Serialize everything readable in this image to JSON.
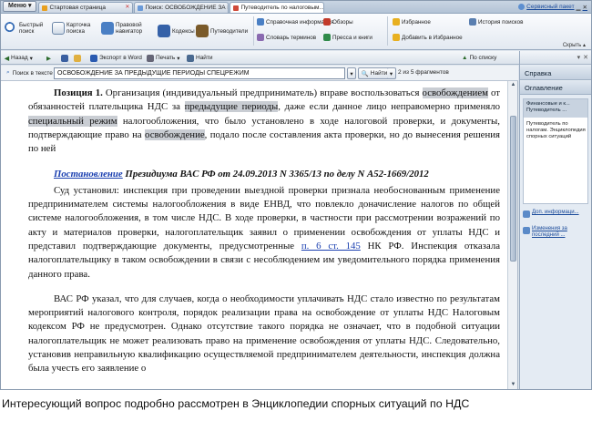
{
  "tabbar": {
    "menu_label": "Меню",
    "tabs": [
      {
        "label": "Стартовая страница",
        "active": false
      },
      {
        "label": "Поиск: ОСВОБОЖДЕНИЕ ЗА ПРЕД...",
        "active": false
      },
      {
        "label": "Путеводитель по налоговым...",
        "active": true
      }
    ],
    "service_label": "Сервисный пакет"
  },
  "ribbon": {
    "quick_search": "Быстрый поиск",
    "card_search": "Карточка поиска",
    "legal_navigator": "Правовой навигатор",
    "codes": "Кодексы",
    "guides": "Путеводители",
    "reference": "Справочная информация",
    "dictionary": "Словарь терминов",
    "reviews": "Обзоры",
    "press": "Пресса и книги",
    "favorites": "Избранное",
    "add_favorites": "Добавить в Избранное",
    "history": "История поисков",
    "collapse": "Скрыть"
  },
  "navbar": {
    "back": "Назад",
    "export_word": "Экспорт в Word",
    "print": "Печать",
    "find": "Найти",
    "by_list": "По списку"
  },
  "findbar": {
    "label": "Поиск в тексте",
    "query": "ОСВОБОЖДЕНИЕ ЗА ПРЕДЫДУЩИЕ ПЕРИОДЫ СПЕЦРЕЖИМ",
    "find_button": "Найти",
    "count": "2 из 5 фрагментов"
  },
  "document": {
    "p1_label": "Позиция 1.",
    "p1_a": " Организация (индивидуальный предприниматель) вправе воспользоваться ",
    "p1_h1": "освобождением",
    "p1_b": " от обязанностей плательщика НДС за ",
    "p1_h2": "предыдущие периоды",
    "p1_c": ", даже если данное лицо неправомерно применяло ",
    "p1_h3": "специальный режим",
    "p1_d": " налогообложения, что было установлено в ходе налоговой проверки, и документы, подтверждающие право на ",
    "p1_h4": "освобождение",
    "p1_e": ", подало после составления акта проверки, но до вынесения решения по ней",
    "ruling_link": "Постановление",
    "ruling_rest": " Президиума ВАС РФ от 24.09.2013 N 3365/13 по делу N А52-1669/2012",
    "p2_a": "Суд установил: инспекция при проведении выездной проверки признала необоснованным применение предпринимателем системы налогообложения в виде ЕНВД, что повлекло доначисление налогов по общей системе налогообложения, в том числе НДС. В ходе проверки, в частности при рассмотрении возражений по акту и материалов проверки, налогоплательщик заявил о применении освобождения от уплаты НДС и представил подтверждающие документы, предусмотренные ",
    "p2_link": "п. 6 ст. 145",
    "p2_b": " НК РФ. Инспекция отказала налогоплательщику в таком освобождении в связи с несоблюдением им уведомительного порядка применения данного права.",
    "p3": "ВАС РФ указал, что для случаев, когда о необходимости уплачивать НДС стало известно по результатам мероприятий налогового контроля, порядок реализации права на освобождение от уплаты НДС Налоговым кодексом РФ не предусмотрен. Однако отсутствие такого порядка не означает, что в подобной ситуации налогоплательщик не может реализовать право на применение освобождения от уплаты НДС. Следовательно, установив неправильную квалификацию осуществляемой предпринимателем деятельности, инспекция должна была учесть его заявление о"
  },
  "panel": {
    "tab_reference": "Справка",
    "tab_contents": "Оглавление",
    "selected_item": "Финансовые и к... Путеводитель ...",
    "box_text": "Путеводитель по налогам. Энциклопедия спорных ситуаций",
    "link1": "Доп. информаци...",
    "link2": "Изменения за последний ..."
  },
  "caption": "Интересующий вопрос подробно рассмотрен в Энциклопедии спорных ситуаций по НДС"
}
